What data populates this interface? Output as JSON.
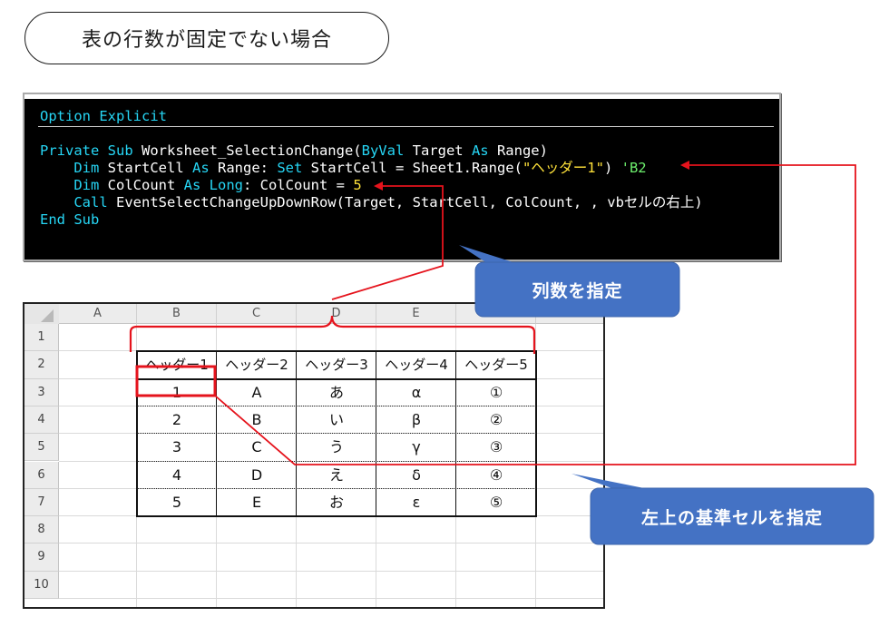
{
  "title": "表の行数が固定でない場合",
  "code": {
    "line1": [
      {
        "t": "Option Explicit",
        "c": "kw"
      }
    ],
    "line2": [
      {
        "t": "Private Sub",
        "c": "kw"
      },
      {
        "t": " Worksheet_SelectionChange(",
        "c": ""
      },
      {
        "t": "ByVal",
        "c": "kw"
      },
      {
        "t": " Target ",
        "c": ""
      },
      {
        "t": "As",
        "c": "kw"
      },
      {
        "t": " Range)",
        "c": ""
      }
    ],
    "line3": [
      {
        "t": "    ",
        "c": ""
      },
      {
        "t": "Dim",
        "c": "kw"
      },
      {
        "t": " StartCell ",
        "c": ""
      },
      {
        "t": "As",
        "c": "kw"
      },
      {
        "t": " Range: ",
        "c": ""
      },
      {
        "t": "Set",
        "c": "kw"
      },
      {
        "t": " StartCell = Sheet1.Range(",
        "c": ""
      },
      {
        "t": "\"ヘッダー1\"",
        "c": "str"
      },
      {
        "t": ") ",
        "c": ""
      },
      {
        "t": "'B2",
        "c": "cmt"
      }
    ],
    "line4": [
      {
        "t": "    ",
        "c": ""
      },
      {
        "t": "Dim",
        "c": "kw"
      },
      {
        "t": " ColCount ",
        "c": ""
      },
      {
        "t": "As Long",
        "c": "kw"
      },
      {
        "t": ": ColCount = ",
        "c": ""
      },
      {
        "t": "5",
        "c": "num"
      }
    ],
    "line5": [
      {
        "t": "    ",
        "c": ""
      },
      {
        "t": "Call",
        "c": "kw"
      },
      {
        "t": " EventSelectChangeUpDownRow(Target, StartCell, ColCount, , vbセルの右上)",
        "c": ""
      }
    ],
    "line6": [
      {
        "t": "End Sub",
        "c": "kw"
      }
    ]
  },
  "sheet": {
    "columns": [
      "A",
      "B",
      "C",
      "D",
      "E",
      "F",
      "G"
    ],
    "rows": [
      "1",
      "2",
      "3",
      "4",
      "5",
      "6",
      "7",
      "8",
      "9",
      "10"
    ],
    "table_headers": [
      "ヘッダー1",
      "ヘッダー2",
      "ヘッダー3",
      "ヘッダー4",
      "ヘッダー5"
    ],
    "table_rows": [
      [
        "1",
        "A",
        "あ",
        "α",
        "①"
      ],
      [
        "2",
        "B",
        "い",
        "β",
        "②"
      ],
      [
        "3",
        "C",
        "う",
        "γ",
        "③"
      ],
      [
        "4",
        "D",
        "え",
        "δ",
        "④"
      ],
      [
        "5",
        "E",
        "お",
        "ε",
        "⑤"
      ]
    ]
  },
  "callouts": {
    "col_count": "列数を指定",
    "start_cell": "左上の基準セルを指定"
  },
  "colors": {
    "callout_fill": "#4472c4",
    "annotation_red": "#e5131c",
    "code_keyword": "#26d6f5",
    "code_string": "#ffe23a",
    "code_comment": "#6df06d"
  }
}
